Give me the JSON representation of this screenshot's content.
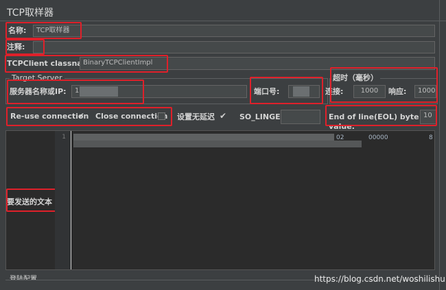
{
  "window": {
    "title": "TCP取样器"
  },
  "name_row": {
    "label": "名称:",
    "value": "TCP取样器"
  },
  "comment_row": {
    "label": "注释:",
    "value": ""
  },
  "classname_row": {
    "label": "TCPClient classname:",
    "value": "BinaryTCPClientImpl"
  },
  "server_group": {
    "title": "Target Server",
    "host_label": "服务器名称或IP:",
    "host_value": "1",
    "port_label": "端口号:",
    "port_value": ""
  },
  "timeout_group": {
    "title": "超时（毫秒）",
    "connect_label": "连接:",
    "connect_value": "1000",
    "response_label": "响应:",
    "response_value": "1000"
  },
  "options_row": {
    "reuse_label": "Re-use connection",
    "reuse_checked": true,
    "close_label": "Close connection",
    "close_checked": false,
    "nodelay_label": "设置无延迟",
    "nodelay_checked": true,
    "solinger_label": "SO_LINGER:",
    "solinger_value": "",
    "eol_label": "End of line(EOL) byte value:",
    "eol_value": "10"
  },
  "text_area": {
    "label": "要发送的文本",
    "line_number": "1",
    "fragment_1": "02",
    "fragment_2": "00000",
    "fragment_3": "8"
  },
  "bottom": {
    "label": "登陆配置"
  },
  "watermark": "https://blog.csdn.net/woshilishu"
}
